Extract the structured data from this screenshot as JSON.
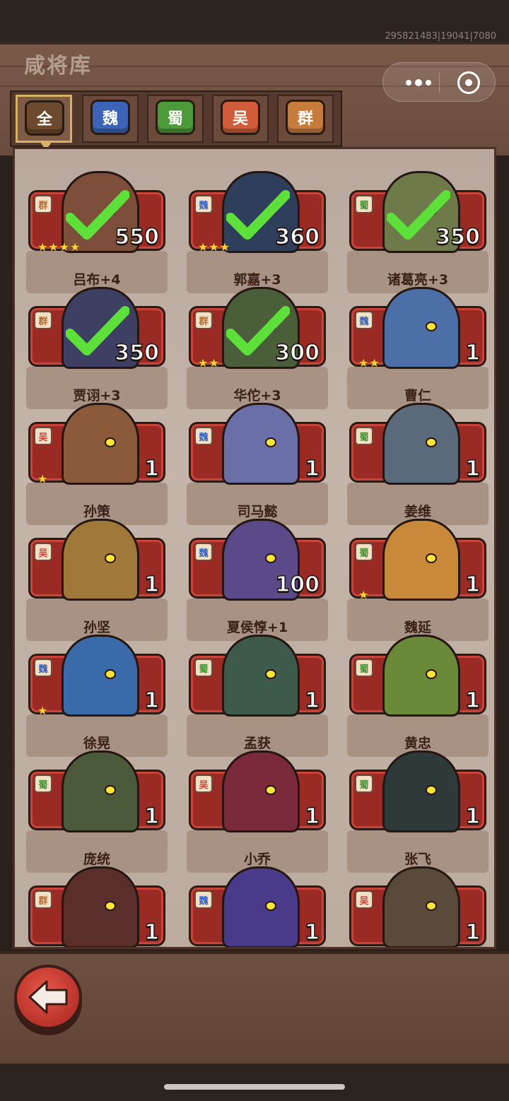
{
  "debug_id": "295821483|19041|7080",
  "title": "咸将库",
  "tabs": [
    {
      "label": "全",
      "color": "#6d4a2e",
      "active": true
    },
    {
      "label": "魏",
      "color": "#3b64b8",
      "active": false
    },
    {
      "label": "蜀",
      "color": "#4c9a3a",
      "active": false
    },
    {
      "label": "吴",
      "color": "#d05c3a",
      "active": false
    },
    {
      "label": "群",
      "color": "#c77c3c",
      "active": false
    }
  ],
  "faction_colors": {
    "群": "#b46a2a",
    "魏": "#2e5fbf",
    "蜀": "#3e8f2e",
    "吴": "#c4453a"
  },
  "generals": [
    {
      "name": "吕布+4",
      "faction": "群",
      "count": "550",
      "stars": 4,
      "owned": true,
      "skin": "#7d4f3a"
    },
    {
      "name": "郭嘉+3",
      "faction": "魏",
      "count": "360",
      "stars": 3,
      "owned": true,
      "skin": "#2f3e5a"
    },
    {
      "name": "诸葛亮+3",
      "faction": "蜀",
      "count": "350",
      "stars": 0,
      "owned": true,
      "skin": "#6f7a4a"
    },
    {
      "name": "贾诩+3",
      "faction": "群",
      "count": "350",
      "stars": 0,
      "owned": true,
      "skin": "#3d3f63"
    },
    {
      "name": "华佗+3",
      "faction": "群",
      "count": "300",
      "stars": 2,
      "owned": true,
      "skin": "#4b5e3a"
    },
    {
      "name": "曹仁",
      "faction": "魏",
      "count": "1",
      "stars": 2,
      "owned": false,
      "skin": "#4d6fa8"
    },
    {
      "name": "孙策",
      "faction": "吴",
      "count": "1",
      "stars": 1,
      "owned": false,
      "skin": "#8a5a3a"
    },
    {
      "name": "司马懿",
      "faction": "魏",
      "count": "1",
      "stars": 0,
      "owned": false,
      "skin": "#6a6fa8"
    },
    {
      "name": "姜维",
      "faction": "蜀",
      "count": "1",
      "stars": 0,
      "owned": false,
      "skin": "#5a6a7a"
    },
    {
      "name": "孙坚",
      "faction": "吴",
      "count": "1",
      "stars": 0,
      "owned": false,
      "skin": "#a0783a"
    },
    {
      "name": "夏侯惇+1",
      "faction": "魏",
      "count": "100",
      "stars": 0,
      "owned": false,
      "skin": "#5a4a8a"
    },
    {
      "name": "魏延",
      "faction": "蜀",
      "count": "1",
      "stars": 1,
      "owned": false,
      "skin": "#c88a3a"
    },
    {
      "name": "徐晃",
      "faction": "魏",
      "count": "1",
      "stars": 1,
      "owned": false,
      "skin": "#3a6aaa"
    },
    {
      "name": "孟获",
      "faction": "蜀",
      "count": "1",
      "stars": 0,
      "owned": false,
      "skin": "#3e5a4a"
    },
    {
      "name": "黄忠",
      "faction": "蜀",
      "count": "1",
      "stars": 0,
      "owned": false,
      "skin": "#6a8a3a"
    },
    {
      "name": "庞统",
      "faction": "蜀",
      "count": "1",
      "stars": 0,
      "owned": false,
      "skin": "#4a5a3a"
    },
    {
      "name": "小乔",
      "faction": "吴",
      "count": "1",
      "stars": 0,
      "owned": false,
      "skin": "#7a2a3a"
    },
    {
      "name": "张飞",
      "faction": "蜀",
      "count": "1",
      "stars": 0,
      "owned": false,
      "skin": "#2e3a3a"
    },
    {
      "name": "",
      "faction": "群",
      "count": "1",
      "stars": 0,
      "owned": false,
      "skin": "#5a2e2a"
    },
    {
      "name": "",
      "faction": "魏",
      "count": "1",
      "stars": 0,
      "owned": false,
      "skin": "#4a3a8a"
    },
    {
      "name": "",
      "faction": "吴",
      "count": "1",
      "stars": 0,
      "owned": false,
      "skin": "#5a4a3a"
    }
  ],
  "icons": {
    "back": "back-arrow-icon",
    "more": "more-dots-icon",
    "close": "target-close-icon"
  }
}
